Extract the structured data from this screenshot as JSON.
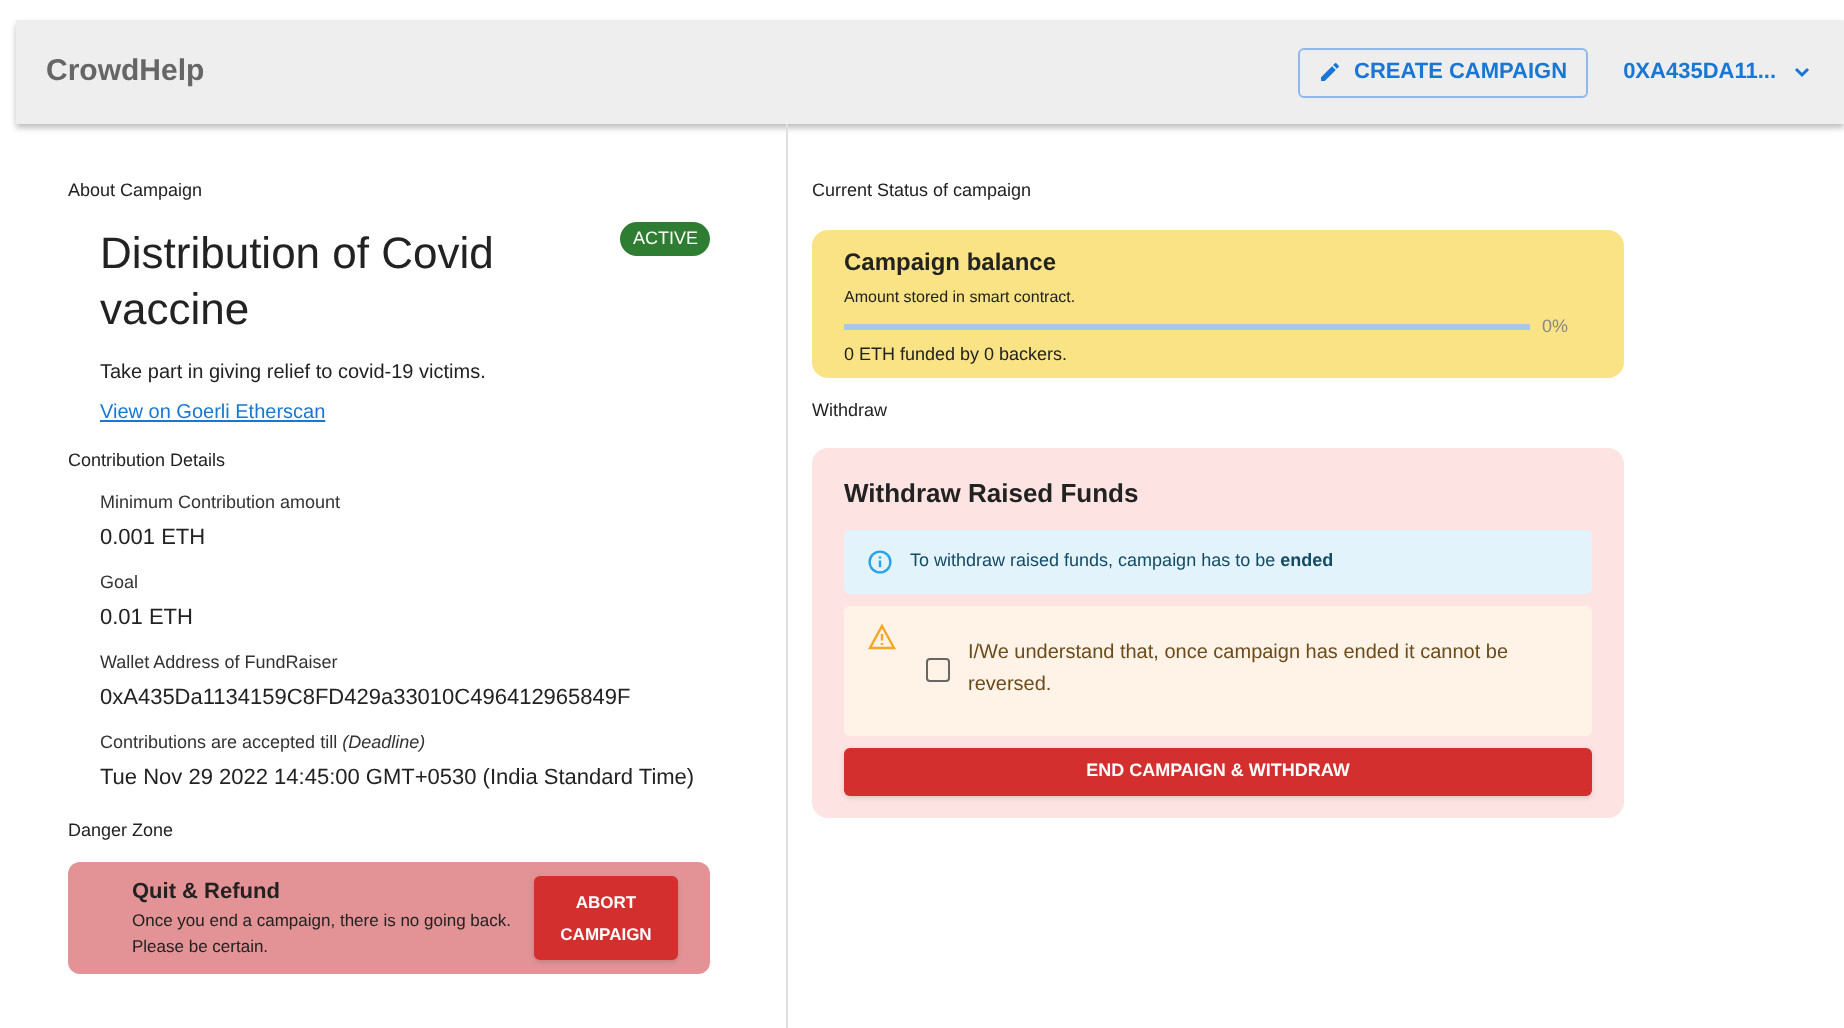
{
  "header": {
    "brand": "CrowdHelp",
    "create_button": "CREATE CAMPAIGN",
    "account": "0XA435DA11..."
  },
  "about": {
    "section_label": "About Campaign",
    "title": "Distribution of Covid vaccine",
    "status": "ACTIVE",
    "description": "Take part in giving relief to covid-19 victims.",
    "link": "View on Goerli Etherscan"
  },
  "contribution": {
    "section_label": "Contribution Details",
    "fields": [
      {
        "label": "Minimum Contribution amount",
        "value": "0.001 ETH"
      },
      {
        "label": "Goal",
        "value": "0.01 ETH"
      },
      {
        "label": "Wallet Address of FundRaiser",
        "value": "0xA435Da1134159C8FD429a33010C496412965849F"
      },
      {
        "label": "Contributions are accepted till *(Deadline)*",
        "value": "Tue Nov 29 2022 14:45:00 GMT+0530 (India Standard Time)"
      }
    ]
  },
  "danger": {
    "section_label": "Danger Zone",
    "title": "Quit & Refund",
    "text": "Once you end a campaign, there is no going back. Please be certain.",
    "button": "ABORT CAMPAIGN"
  },
  "status": {
    "section_label": "Current Status of campaign",
    "title": "Campaign balance",
    "subtitle": "Amount stored in smart contract.",
    "level": 0,
    "percent": "0%",
    "funded": "0 ETH funded by 0 backers."
  },
  "withdraw": {
    "section_label": "Withdraw",
    "title": "Withdraw Raised Funds",
    "info": "To withdraw raised funds, campaign has to be **ended**",
    "confirm": {
      "label": "I/We understand that, once campaign has ended it cannot be reversed.",
      "checked": false
    },
    "button": "END CAMPAIGN & WITHDRAW"
  }
}
